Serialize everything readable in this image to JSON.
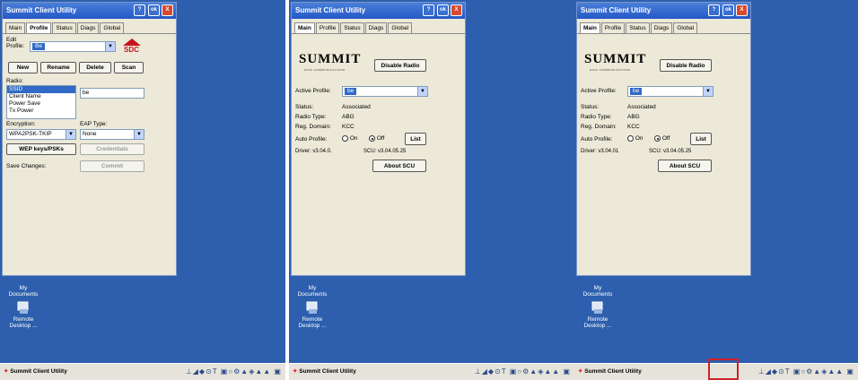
{
  "window": {
    "title": "Summit Client Utility",
    "help_btn": "?",
    "ok_btn": "ok",
    "close_btn": "X",
    "tabs": [
      "Main",
      "Profile",
      "Status",
      "Diags",
      "Global"
    ]
  },
  "profile_screen": {
    "edit_profile_label": "Edit Profile:",
    "edit_profile_value": "Be",
    "sdc_logo": "SDC",
    "buttons": {
      "new": "New",
      "rename": "Rename",
      "delete": "Delete",
      "scan": "Scan"
    },
    "radio_label": "Radio:",
    "radio_list": [
      "SSID",
      "Client Name",
      "Power Save",
      "Tx Power"
    ],
    "radio_value": "be",
    "encryption_label": "Encryption:",
    "encryption_value": "WPA2PSK-TKIP",
    "eap_type_label": "EAP Type:",
    "eap_type_value": "None",
    "wep_keys_button": "WEP keys/PSKs",
    "credentials_button": "Credentials",
    "save_changes_label": "Save Changes:",
    "commit_button": "Commit"
  },
  "main_screen_a": {
    "logo": "SUMMIT",
    "logo_sub": "DATA COMMUNICATIONS",
    "disable_radio": "Disable Radio",
    "active_profile_label": "Active Profile:",
    "active_profile_value": "be",
    "status_label": "Status:",
    "status_value": "Associated",
    "radio_type_label": "Radio Type:",
    "radio_type_value": "ABG",
    "reg_domain_label": "Reg. Domain:",
    "reg_domain_value": "KCC",
    "auto_profile_label": "Auto Profile:",
    "on_label": "On",
    "off_label": "Off",
    "list_button": "List",
    "driver_text": "Driver: v3.04.0.",
    "scu_text": "SCU: v3.04.05.25",
    "about_button": "About SCU"
  },
  "main_screen_b": {
    "logo": "SUMMIT",
    "logo_sub": "DATA COMMUNICATIONS",
    "disable_radio": "Disable Radio",
    "active_profile_label": "Active Profile:",
    "active_profile_value": "be",
    "status_label": "Status:",
    "status_value": "Associated",
    "radio_type_label": "Radio Type:",
    "radio_type_value": "ABG",
    "reg_domain_label": "Reg. Domain:",
    "reg_domain_value": "KCC",
    "auto_profile_label": "Auto Profile:",
    "on_label": "On",
    "off_label": "Off",
    "list_button": "List",
    "driver_text": "Driver: v3.04.01",
    "scu_text": "SCU: v3.04.05.25",
    "about_button": "About SCU"
  },
  "desktop": {
    "my_documents": "My Documents",
    "remote_desktop": "Remote Desktop ..."
  },
  "taskbar": {
    "app_label": "Summit Client Utility",
    "tray_icons": "⊥◢◆⊙T ▣○⚙▲◈▲▲ ▣"
  },
  "colors": {
    "desktop": "#2d5fae",
    "titlebar": "#2458c8",
    "highlight": "#d0202a",
    "window": "#ece9d8"
  }
}
